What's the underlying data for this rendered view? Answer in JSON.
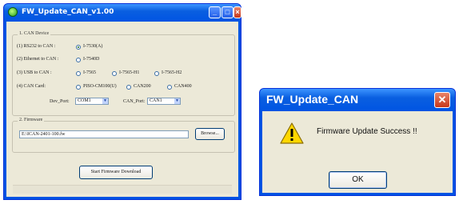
{
  "main_window": {
    "title": "FW_Update_CAN_v1.00",
    "can_device_group": "1. CAN Device",
    "rows": {
      "rs232_label": "(1) RS232 to CAN :",
      "rs232_option": "I-7530(A)",
      "ethernet_label": "(2) Ethernet to CAN :",
      "ethernet_option": "I-7540D",
      "usb_label": "(3) USB to CAN :",
      "usb_options": [
        "I-7565",
        "I-7565-H1",
        "I-7565-H2"
      ],
      "can_card_label": "(4) CAN Card:",
      "can_card_options": [
        "PISO-CM100(U)",
        "CAN200",
        "CAN400"
      ]
    },
    "dev_port_label": "Dev_Port:",
    "dev_port_value": "COM1",
    "can_port_label": "CAN_Port:",
    "can_port_value": "CAN1",
    "firmware_group": "2. Firmware",
    "firmware_path": "E:\\ICAN-2401-100.fw",
    "browse_label": "Browse...",
    "start_label": "Start Firmware Download"
  },
  "dialog": {
    "title": "FW_Update_CAN",
    "message": "Firmware Update Success !!",
    "ok_label": "OK",
    "icon": "warning-icon"
  },
  "colors": {
    "titlebar": "#0054e3",
    "client": "#ece9d8",
    "close": "#c7371a"
  }
}
